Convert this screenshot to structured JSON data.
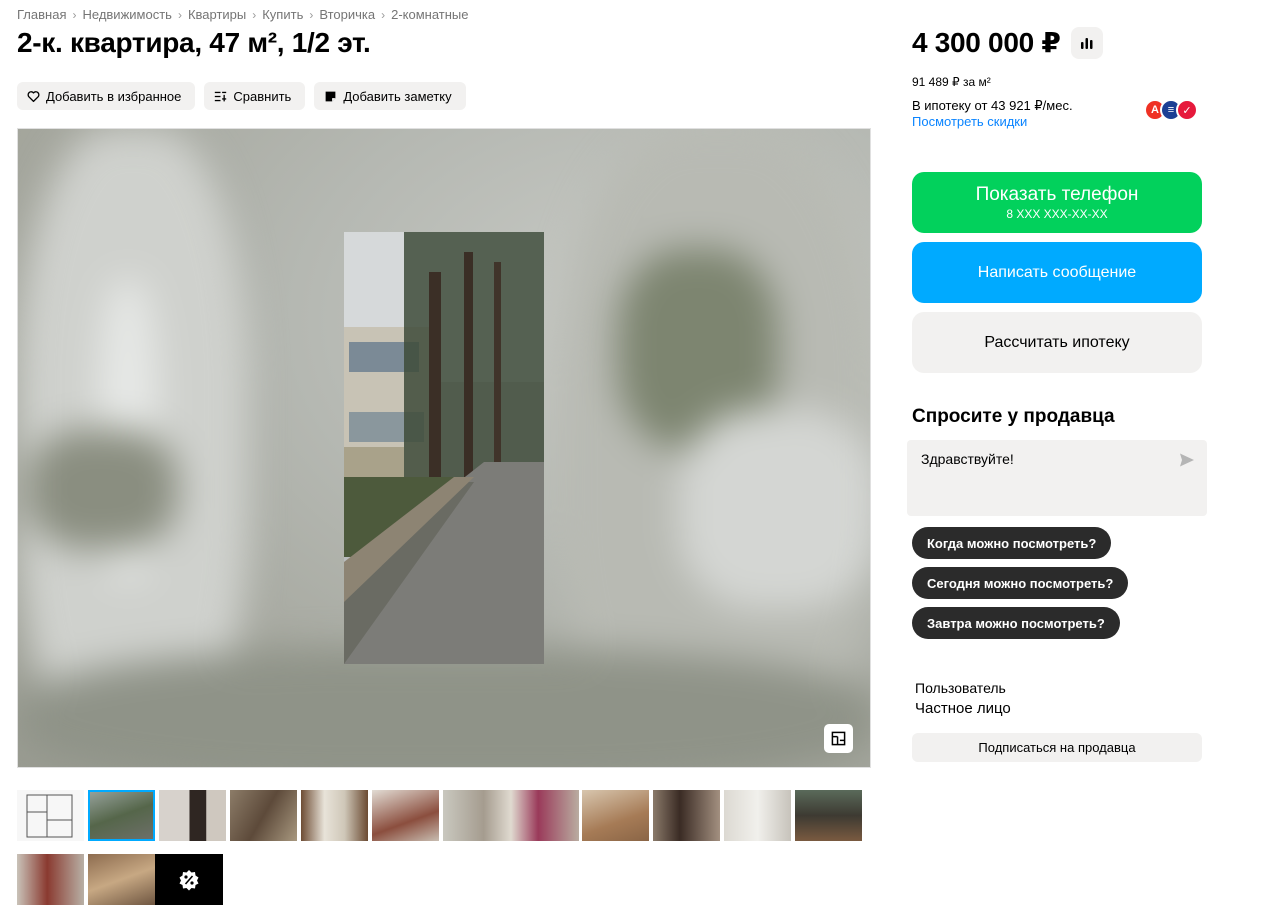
{
  "breadcrumb": [
    "Главная",
    "Недвижимость",
    "Квартиры",
    "Купить",
    "Вторичка",
    "2-комнатные"
  ],
  "breadcrumb_separator": "›",
  "title": "2-к. квартира, 47 м², 1/2 эт.",
  "actions": {
    "favorite": "Добавить в избранное",
    "compare": "Сравнить",
    "note": "Добавить заметку"
  },
  "price": "4 300 000 ₽",
  "price_per_m": "91 489 ₽ за м²",
  "mortgage_from": "В ипотеку от 43 921 ₽/мес.",
  "discounts_link": "Посмотреть скидки",
  "banks": [
    {
      "icon": "alfa-bank-icon",
      "glyph": "А",
      "color": "#ef3124"
    },
    {
      "icon": "vtb-bank-icon",
      "glyph": "≡",
      "color": "#1c3f94"
    },
    {
      "icon": "sovcombank-icon",
      "glyph": "✓",
      "color": "#e6193c"
    }
  ],
  "buttons": {
    "show_phone": "Показать телефон",
    "phone_masked": "8 XXX XXX-XX-XX",
    "write_message": "Написать сообщение",
    "calc_mortgage": "Рассчитать ипотеку"
  },
  "ask": {
    "title": "Спросите у продавца",
    "message": "Здравствуйте!",
    "chips": [
      "Когда можно посмотреть?",
      "Сегодня можно посмотреть?",
      "Завтра можно посмотреть?"
    ]
  },
  "seller": {
    "name": "Пользователь",
    "type": "Частное лицо",
    "subscribe": "Подписаться на продавца"
  },
  "colors": {
    "green": "#02d15c",
    "blue": "#00aaff",
    "link": "#0a84ff",
    "chip": "#2b2b2b",
    "gray_bg": "#f2f1f0"
  }
}
